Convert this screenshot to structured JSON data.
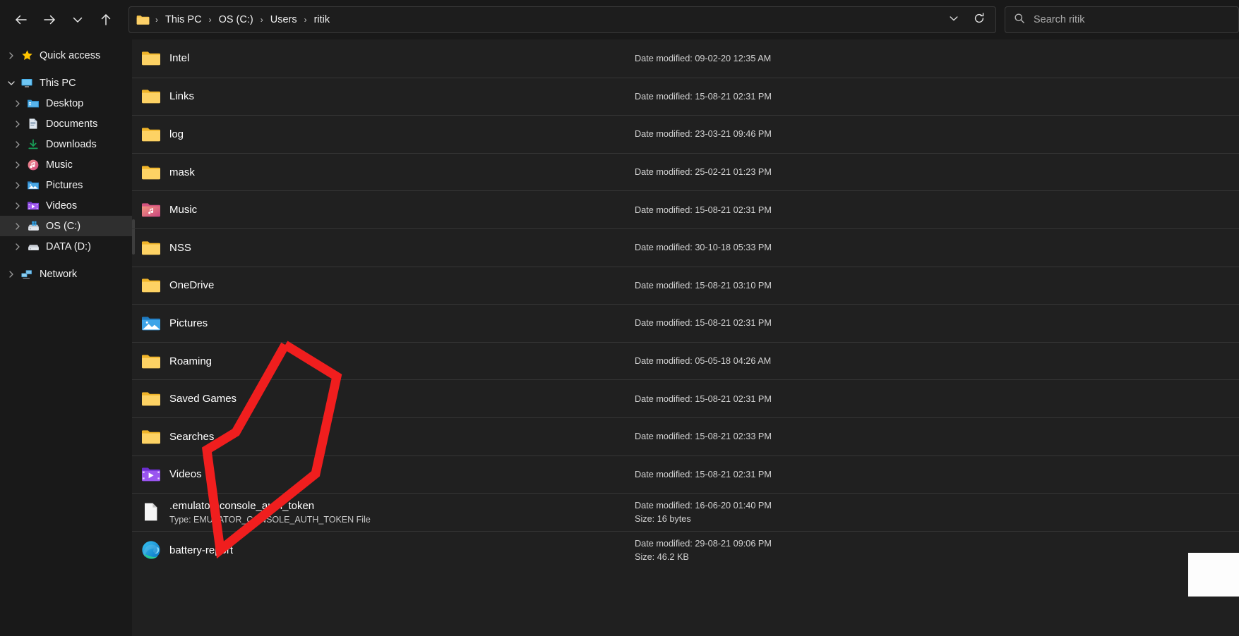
{
  "window": {
    "title": "File Explorer"
  },
  "toolbar": {
    "back_icon": "arrow-left-icon",
    "forward_icon": "arrow-right-icon",
    "recent_icon": "chevron-down-icon",
    "up_icon": "arrow-up-icon",
    "dropdown_icon": "chevron-down-icon",
    "refresh_icon": "refresh-icon"
  },
  "address": {
    "folder_icon": "folder-icon",
    "crumbs": [
      "This PC",
      "OS (C:)",
      "Users",
      "ritik"
    ],
    "separator": "›"
  },
  "search": {
    "icon": "search-icon",
    "placeholder": "Search ritik",
    "value": "Search ritik"
  },
  "sidebar": {
    "items": [
      {
        "label": "Quick access",
        "icon": "star-icon",
        "depth": 0,
        "expanded": false,
        "selected": false
      },
      {
        "label": "This PC",
        "icon": "monitor-icon",
        "depth": 0,
        "expanded": true,
        "selected": false
      },
      {
        "label": "Desktop",
        "icon": "desktop-folder-icon",
        "depth": 1,
        "expanded": false,
        "selected": false
      },
      {
        "label": "Documents",
        "icon": "documents-icon",
        "depth": 1,
        "expanded": false,
        "selected": false
      },
      {
        "label": "Downloads",
        "icon": "downloads-icon",
        "depth": 1,
        "expanded": false,
        "selected": false
      },
      {
        "label": "Music",
        "icon": "music-icon",
        "depth": 1,
        "expanded": false,
        "selected": false
      },
      {
        "label": "Pictures",
        "icon": "pictures-icon",
        "depth": 1,
        "expanded": false,
        "selected": false
      },
      {
        "label": "Videos",
        "icon": "videos-icon",
        "depth": 1,
        "expanded": false,
        "selected": false
      },
      {
        "label": "OS (C:)",
        "icon": "drive-windows-icon",
        "depth": 1,
        "expanded": false,
        "selected": true
      },
      {
        "label": "DATA (D:)",
        "icon": "drive-icon",
        "depth": 1,
        "expanded": false,
        "selected": false
      },
      {
        "label": "Network",
        "icon": "network-icon",
        "depth": 0,
        "expanded": false,
        "selected": false
      }
    ]
  },
  "filelist": {
    "meta_label_date": "Date modified:",
    "rows": [
      {
        "name": "Intel",
        "icon": "folder-icon",
        "date": "Date modified: 09-02-20 12:35 AM",
        "sub": "",
        "size": ""
      },
      {
        "name": "Links",
        "icon": "folder-icon",
        "date": "Date modified: 15-08-21 02:31 PM",
        "sub": "",
        "size": ""
      },
      {
        "name": "log",
        "icon": "folder-icon",
        "date": "Date modified: 23-03-21 09:46 PM",
        "sub": "",
        "size": ""
      },
      {
        "name": "mask",
        "icon": "folder-icon",
        "date": "Date modified: 25-02-21 01:23 PM",
        "sub": "",
        "size": ""
      },
      {
        "name": "Music",
        "icon": "music-folder-icon",
        "date": "Date modified: 15-08-21 02:31 PM",
        "sub": "",
        "size": ""
      },
      {
        "name": "NSS",
        "icon": "folder-icon",
        "date": "Date modified: 30-10-18 05:33 PM",
        "sub": "",
        "size": ""
      },
      {
        "name": "OneDrive",
        "icon": "folder-icon",
        "date": "Date modified: 15-08-21 03:10 PM",
        "sub": "",
        "size": ""
      },
      {
        "name": "Pictures",
        "icon": "pictures-folder-icon",
        "date": "Date modified: 15-08-21 02:31 PM",
        "sub": "",
        "size": ""
      },
      {
        "name": "Roaming",
        "icon": "folder-icon",
        "date": "Date modified: 05-05-18 04:26 AM",
        "sub": "",
        "size": ""
      },
      {
        "name": "Saved Games",
        "icon": "folder-icon",
        "date": "Date modified: 15-08-21 02:31 PM",
        "sub": "",
        "size": ""
      },
      {
        "name": "Searches",
        "icon": "folder-icon",
        "date": "Date modified: 15-08-21 02:33 PM",
        "sub": "",
        "size": ""
      },
      {
        "name": "Videos",
        "icon": "videos-folder-icon",
        "date": "Date modified: 15-08-21 02:31 PM",
        "sub": "",
        "size": ""
      },
      {
        "name": ".emulator_console_auth_token",
        "icon": "file-blank-icon",
        "date": "Date modified: 16-06-20 01:40 PM",
        "sub": "Type: EMULATOR_CONSOLE_AUTH_TOKEN File",
        "size": "Size: 16 bytes"
      },
      {
        "name": "battery-report",
        "icon": "edge-browser-icon",
        "date": "Date modified: 29-08-21 09:06 PM",
        "sub": "",
        "size": "Size: 46.2 KB"
      }
    ]
  },
  "annotation": {
    "shape": "red-arrow-overlay",
    "color": "#f01e1e"
  }
}
